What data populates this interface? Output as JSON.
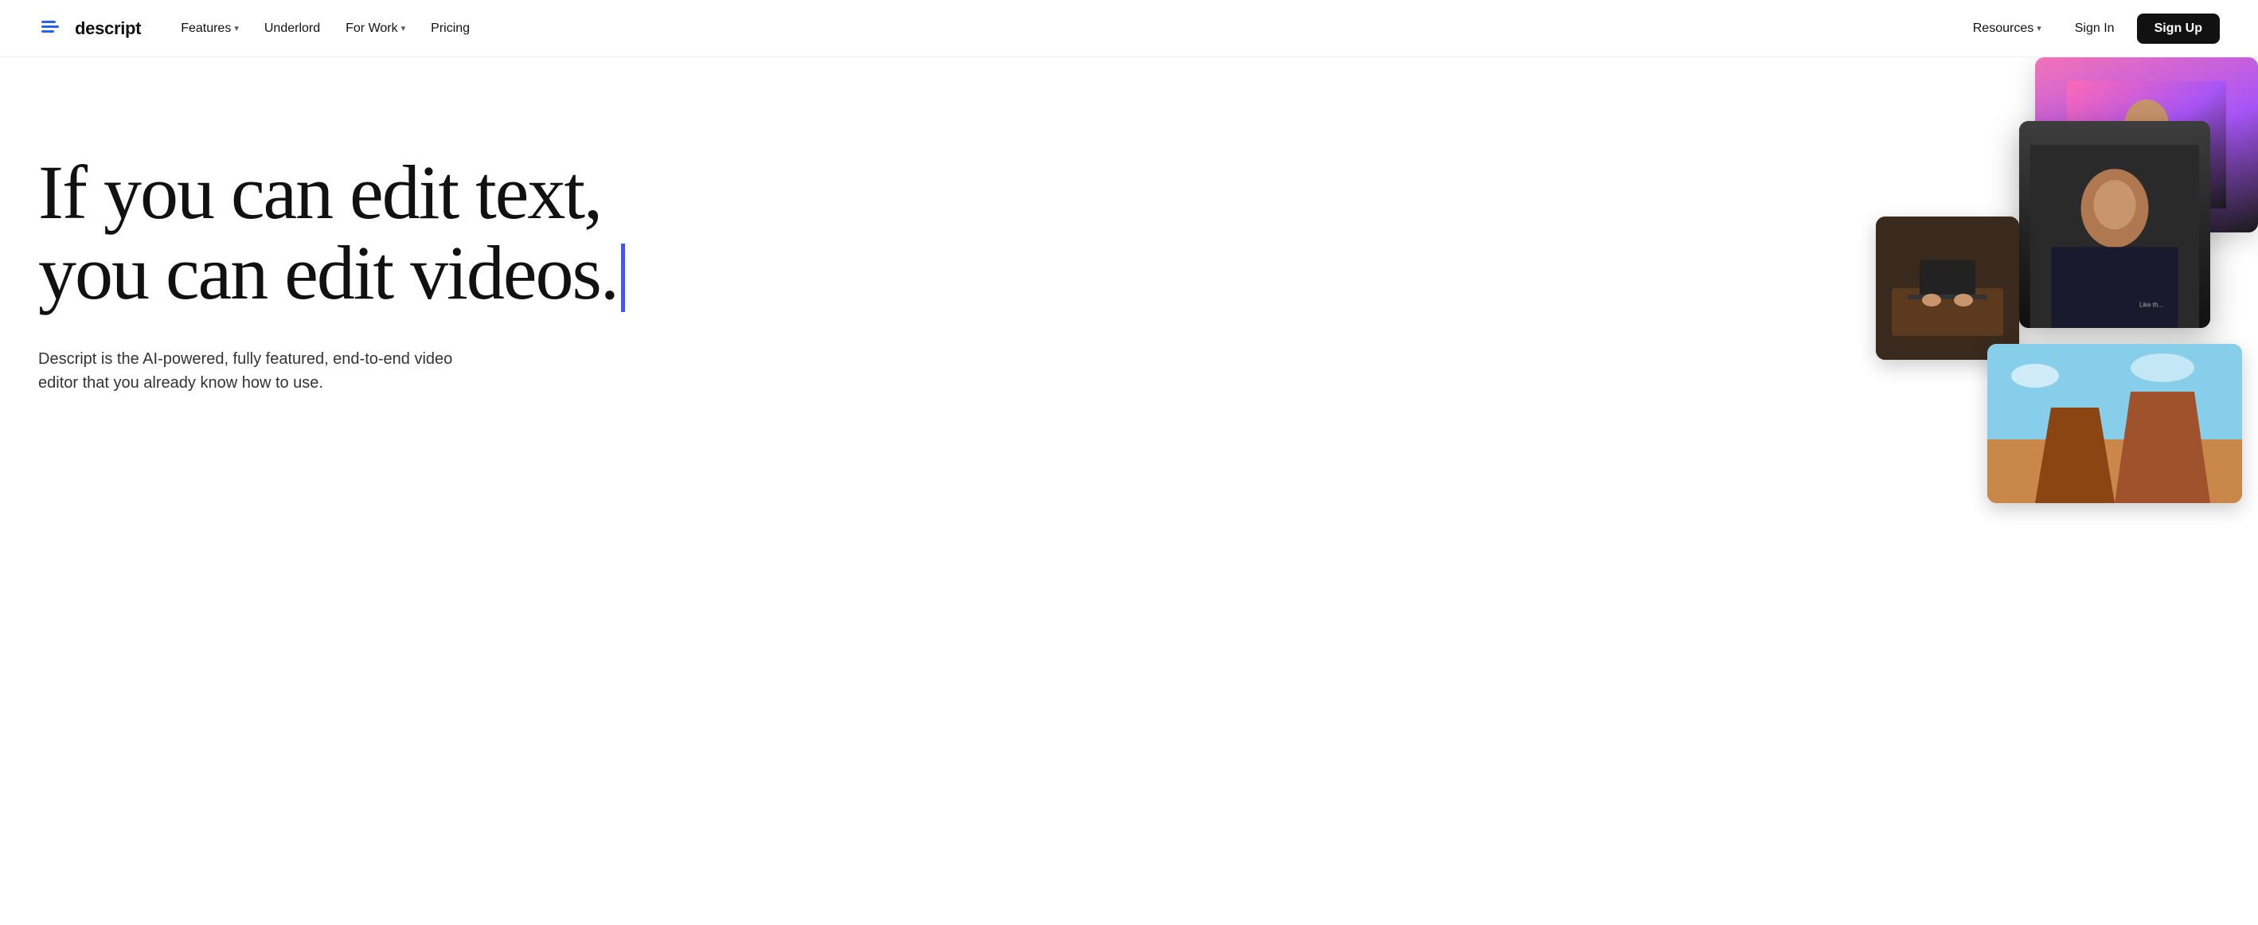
{
  "brand": {
    "name": "descript",
    "logo_alt": "Descript logo"
  },
  "nav": {
    "links": [
      {
        "label": "Features",
        "has_dropdown": true
      },
      {
        "label": "Underlord",
        "has_dropdown": false
      },
      {
        "label": "For Work",
        "has_dropdown": true
      },
      {
        "label": "Pricing",
        "has_dropdown": false
      }
    ],
    "right_links": [
      {
        "label": "Resources",
        "has_dropdown": true
      },
      {
        "label": "Sign In",
        "has_dropdown": false
      }
    ],
    "cta_label": "Sign Up"
  },
  "hero": {
    "headline_line1": "If you can edit text,",
    "headline_line2": "you can edit videos.",
    "subtext": "Descript is the AI-powered, fully featured, end-to-end video editor that you already know how to use.",
    "cursor_color": "#4355f5"
  }
}
